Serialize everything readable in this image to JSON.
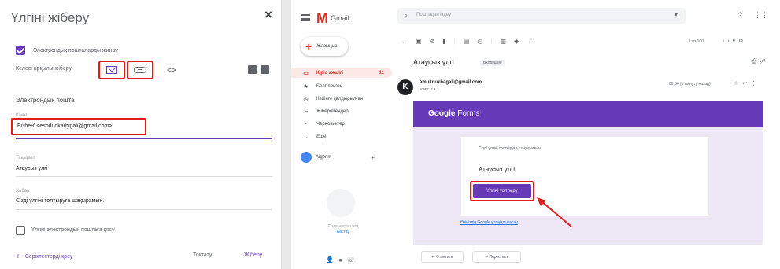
{
  "dialog": {
    "title": "Үлгіні жіберу",
    "close": "×",
    "collect_email_label": "Электрондық пошталарды жинау",
    "send_via_label": "Келесі арқылы жіберу",
    "section_title": "Электрондық пошта",
    "to_label": "Кімге",
    "to_value": "Бізбен' <esoduokartygali@gmail.com>",
    "subject_label": "Тақырып",
    "subject_value": "Атаусыз үлгі",
    "message_label": "Хабар",
    "message_value": "Сізді үлгіні толтыруға шақырамын.",
    "copy_label": "Үлгіні электрондық поштаға қосу",
    "add_collaborators": "Серіктестерді қосу",
    "cancel": "Тоқтату",
    "send": "Жіберу"
  },
  "gmail": {
    "brand": "Gmail",
    "search_placeholder": "Поштадан іздеу",
    "compose": "Жазыңыз",
    "nav": [
      {
        "label": "Кіріс жәшігі",
        "count": "11",
        "icon": "▭"
      },
      {
        "label": "Белгіленген",
        "count": "",
        "icon": "★"
      },
      {
        "label": "Кейінге қалдырылған",
        "count": "",
        "icon": "◷"
      },
      {
        "label": "Жіберілгендер",
        "count": "",
        "icon": "➢"
      },
      {
        "label": "Черновиктер",
        "count": "",
        "icon": "▪"
      },
      {
        "label": "Ещё",
        "count": "",
        "icon": "⌄"
      }
    ],
    "account_name": "Aigerim",
    "hangouts_text": "Сізде чаттар жоқ",
    "hangouts_link": "Бастау",
    "pager": "1 из 100",
    "subject": "Атаусыз үлгі",
    "inbox_tag": "Входящие",
    "sender_initial": "K",
    "sender": "amukdukhagali@gmail.com",
    "to_me": "кому: я ▾",
    "date": "09:56 (1 минуту назад)",
    "forms_logo_bold": "Google",
    "forms_logo_rest": " Forms",
    "invite_text": "Сізді үлгіні толтыруға шақырамын.",
    "form_title": "Атаусыз үлгі",
    "fill_button": "Үлгіні толтыру",
    "footer_link": "Өзіңіздің Google үлгіңізді жасау",
    "reply": "Ответить",
    "forward": "Переслать"
  },
  "colors": {
    "accent_purple": "#673ab7",
    "highlight_red": "#e11a1a",
    "gmail_red": "#d93025"
  }
}
